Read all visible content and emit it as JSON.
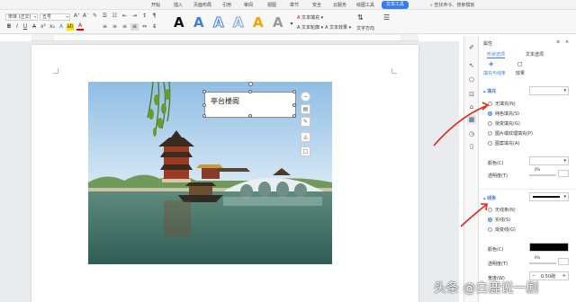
{
  "menubar": {
    "items": [
      "开始",
      "插入",
      "页面布局",
      "引用",
      "审阅",
      "视图",
      "章节",
      "安全",
      "云服务",
      "绘图工具",
      "文本工具"
    ],
    "active_index": 10,
    "right": "查找命令、搜索模板"
  },
  "ribbon": {
    "font_name": "宋体 (正文)",
    "font_size": "五号",
    "text_fill": "文本填充",
    "text_outline": "文本轮廓",
    "text_effect": "文本效果",
    "text_direction": "文字方向",
    "art_glyph": "A"
  },
  "textbox": {
    "text": "亭台楼阁"
  },
  "panel": {
    "title": "属性",
    "tab_shape": "形状选项",
    "tab_text": "文本选项",
    "subtab_fill": "填充与线条",
    "subtab_effect": "效果",
    "fill_section": "填充",
    "fill_options": [
      "无填充(N)",
      "纯色填充(S)",
      "渐变填充(G)",
      "图片或纹理填充(P)",
      "图案填充(A)"
    ],
    "fill_selected": 1,
    "color_label": "颜色(C)",
    "transparency_label": "透明度(T)",
    "transparency_value": "0%",
    "line_section": "线条",
    "line_options": [
      "无线条(N)",
      "实线(S)",
      "渐变线(G)"
    ],
    "line_selected": 1,
    "line_color_label": "颜色(C)",
    "line_transparency_label": "透明度(T)",
    "line_transparency_value": "0%",
    "width_label": "宽度(W)",
    "width_value": "0.50磅"
  },
  "watermark": "头条 @白鹿说一剧",
  "colors": {
    "accent": "#3b7cf0",
    "arrow": "#e0241b"
  }
}
